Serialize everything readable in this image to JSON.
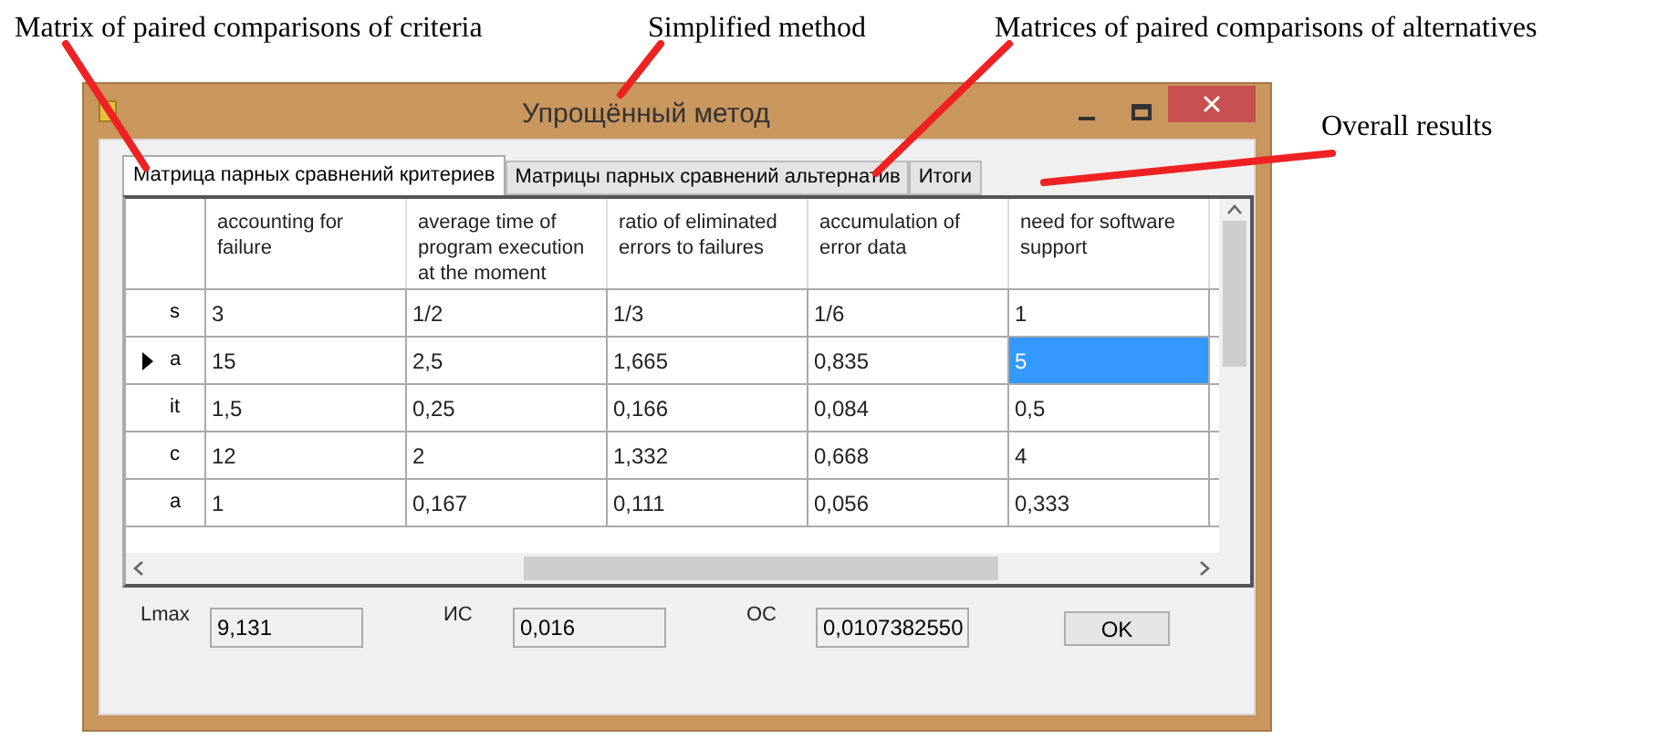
{
  "annotations": [
    {
      "text": "Matrix of paired comparisons of criteria"
    },
    {
      "text": "Simplified method"
    },
    {
      "text": "Matrices of paired comparisons of alternatives"
    },
    {
      "text": "Overall results"
    }
  ],
  "window": {
    "title": "Упрощённый метод"
  },
  "tabs": [
    {
      "label": "Матрица парных сравнений критериев",
      "selected": true
    },
    {
      "label": "Матрицы парных сравнений альтернатив",
      "selected": false
    },
    {
      "label": "Итоги",
      "selected": false
    }
  ],
  "table": {
    "columns": [
      "accounting for failure",
      "average time of program execution at the moment",
      "ratio of eliminated errors to failures",
      "accumulation of error data",
      "need for software support"
    ],
    "rows": [
      {
        "header": "s",
        "current": false,
        "cells": [
          {
            "text": "3",
            "selected": false
          },
          {
            "text": "1/2",
            "selected": false
          },
          {
            "text": "1/3",
            "selected": false
          },
          {
            "text": "1/6",
            "selected": false
          },
          {
            "text": "1",
            "selected": false
          }
        ]
      },
      {
        "header": "a",
        "current": true,
        "cells": [
          {
            "text": "15",
            "selected": false
          },
          {
            "text": "2,5",
            "selected": false
          },
          {
            "text": "1,665",
            "selected": false
          },
          {
            "text": "0,835",
            "selected": false
          },
          {
            "text": "5",
            "selected": true
          }
        ]
      },
      {
        "header": "it",
        "current": false,
        "cells": [
          {
            "text": "1,5",
            "selected": false
          },
          {
            "text": "0,25",
            "selected": false
          },
          {
            "text": "0,166",
            "selected": false
          },
          {
            "text": "0,084",
            "selected": false
          },
          {
            "text": "0,5",
            "selected": false
          }
        ]
      },
      {
        "header": "c",
        "current": false,
        "cells": [
          {
            "text": "12",
            "selected": false
          },
          {
            "text": "2",
            "selected": false
          },
          {
            "text": "1,332",
            "selected": false
          },
          {
            "text": "0,668",
            "selected": false
          },
          {
            "text": "4",
            "selected": false
          }
        ]
      },
      {
        "header": "a",
        "current": false,
        "cells": [
          {
            "text": "1",
            "selected": false
          },
          {
            "text": "0,167",
            "selected": false
          },
          {
            "text": "0,111",
            "selected": false
          },
          {
            "text": "0,056",
            "selected": false
          },
          {
            "text": "0,333",
            "selected": false
          }
        ]
      }
    ]
  },
  "fields": [
    {
      "label": "Lmax",
      "value": "9,131"
    },
    {
      "label": "ИС",
      "value": "0,016"
    },
    {
      "label": "ОС",
      "value": "0,0107382550"
    }
  ],
  "ok_button": "OK"
}
